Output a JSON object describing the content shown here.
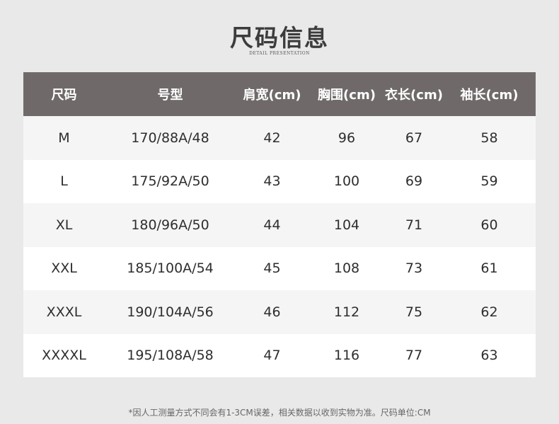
{
  "title": "尺码信息",
  "subtitle": "DETAIL PRESENTATION",
  "table": {
    "headers": [
      "尺码",
      "号型",
      "肩宽(cm)",
      "胸围(cm)",
      "衣长(cm)",
      "袖长(cm)"
    ],
    "rows": [
      [
        "M",
        "170/88A/48",
        "42",
        "96",
        "67",
        "58"
      ],
      [
        "L",
        "175/92A/50",
        "43",
        "100",
        "69",
        "59"
      ],
      [
        "XL",
        "180/96A/50",
        "44",
        "104",
        "71",
        "60"
      ],
      [
        "XXL",
        "185/100A/54",
        "45",
        "108",
        "73",
        "61"
      ],
      [
        "XXXL",
        "190/104A/56",
        "46",
        "112",
        "75",
        "62"
      ],
      [
        "XXXXL",
        "195/108A/58",
        "47",
        "116",
        "77",
        "63"
      ]
    ]
  },
  "note": "*因人工测量方式不同会有1-3CM误差，相关数据以收到实物为准。尺码单位:CM",
  "colors": {
    "background": "#e9e9e9",
    "header_bg": "#6f6a69",
    "row_odd": "#f5f5f5",
    "row_even": "#ffffff"
  }
}
